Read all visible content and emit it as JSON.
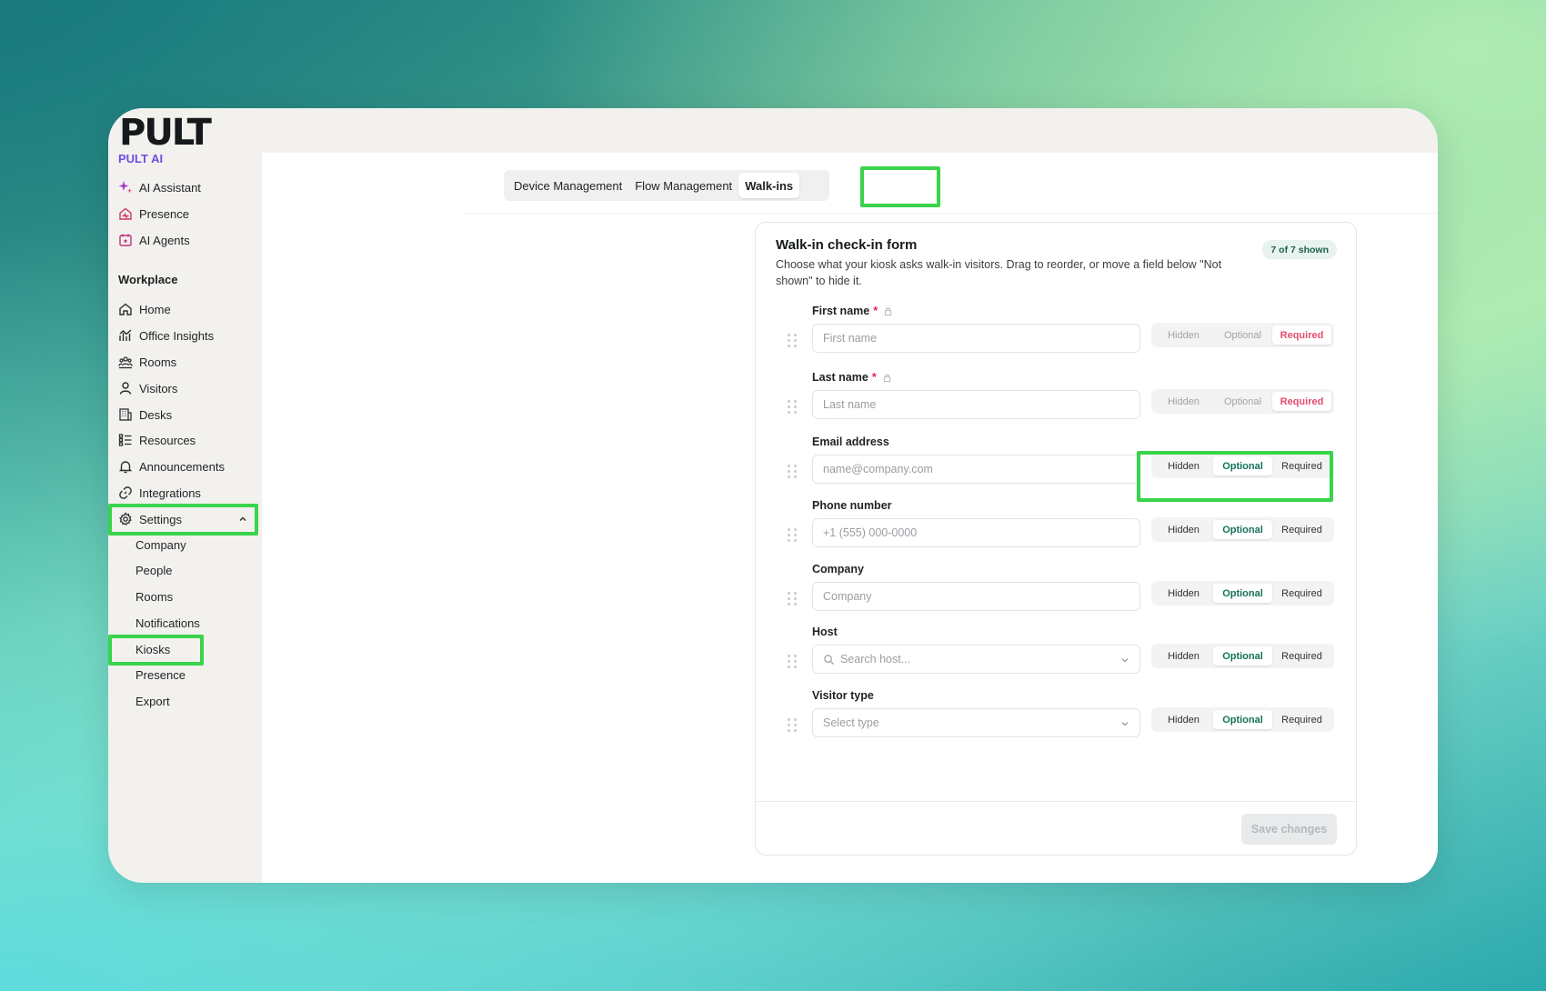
{
  "brand": {
    "logo": "PULT",
    "sub": "PULT AI"
  },
  "ai_nav": [
    {
      "label": "AI Assistant",
      "icon": "sparkle-icon"
    },
    {
      "label": "Presence",
      "icon": "home-pulse-icon"
    },
    {
      "label": "AI Agents",
      "icon": "calendar-star-icon"
    }
  ],
  "workplace": {
    "label": "Workplace",
    "items": [
      {
        "label": "Home",
        "icon": "home-icon"
      },
      {
        "label": "Office Insights",
        "icon": "chart-icon"
      },
      {
        "label": "Rooms",
        "icon": "people-group-icon"
      },
      {
        "label": "Visitors",
        "icon": "user-icon"
      },
      {
        "label": "Desks",
        "icon": "building-icon"
      },
      {
        "label": "Resources",
        "icon": "list-grid-icon"
      },
      {
        "label": "Announcements",
        "icon": "bell-icon"
      },
      {
        "label": "Integrations",
        "icon": "link-icon"
      },
      {
        "label": "Settings",
        "icon": "gear-icon"
      }
    ]
  },
  "settings_sub": [
    "Company",
    "People",
    "Rooms",
    "Notifications",
    "Kiosks",
    "Presence",
    "Export"
  ],
  "tabs": [
    "Device Management",
    "Flow Management",
    "Walk-ins"
  ],
  "form": {
    "title": "Walk-in check-in form",
    "description": "Choose what your kiosk asks walk-in visitors. Drag to reorder, or move a field below \"Not shown\" to hide it.",
    "count_badge": "7 of 7 shown",
    "options": [
      "Hidden",
      "Optional",
      "Required"
    ],
    "fields": [
      {
        "label": "First name",
        "required_mark": "*",
        "placeholder": "First name",
        "selected": "Required",
        "locked": true
      },
      {
        "label": "Last name",
        "required_mark": "*",
        "placeholder": "Last name",
        "selected": "Required",
        "locked": true
      },
      {
        "label": "Email address",
        "required_mark": "",
        "placeholder": "name@company.com",
        "selected": "Optional",
        "locked": false
      },
      {
        "label": "Phone number",
        "required_mark": "",
        "placeholder": "+1 (555) 000-0000",
        "selected": "Optional",
        "locked": false
      },
      {
        "label": "Company",
        "required_mark": "",
        "placeholder": "Company",
        "selected": "Optional",
        "locked": false
      },
      {
        "label": "Host",
        "required_mark": "",
        "placeholder": "Search host...",
        "selected": "Optional",
        "locked": false
      },
      {
        "label": "Visitor type",
        "required_mark": "",
        "placeholder": "Select type",
        "selected": "Optional",
        "locked": false
      }
    ],
    "save_label": "Save changes"
  },
  "colors": {
    "highlight": "#39d44b",
    "brand_purple": "#6b4fe0",
    "optional_green": "#14735a",
    "required_pink": "#e34d6e"
  }
}
